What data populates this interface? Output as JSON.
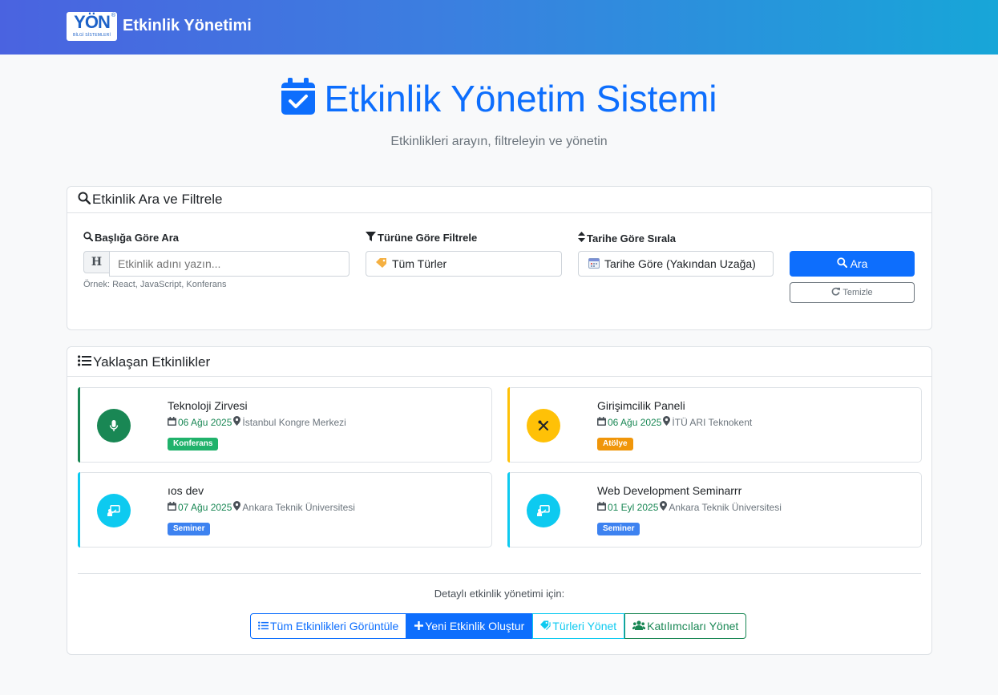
{
  "navbar": {
    "logo_text": "YÖN",
    "logo_sub": "BİLGİ SİSTEMLERİ",
    "logo_reg": "®",
    "brand": "Etkinlik Yönetimi"
  },
  "hero": {
    "title": "Etkinlik Yönetim Sistemi",
    "subtitle": "Etkinlikleri arayın, filtreleyin ve yönetin"
  },
  "search_card": {
    "header": "Etkinlik Ara ve Filtrele",
    "title_label": "Başlığa Göre Ara",
    "title_prefix": "H",
    "title_placeholder": "Etkinlik adını yazın...",
    "hint": "Örnek: React, JavaScript, Konferans",
    "type_label": "Türüne Göre Filtrele",
    "type_value": "Tüm Türler",
    "date_label": "Tarihe Göre Sırala",
    "date_value": "Tarihe Göre (Yakından Uzağa)",
    "search_button": "Ara",
    "clear_button": "Temizle"
  },
  "upcoming": {
    "header": "Yaklaşan Etkinlikler",
    "events": [
      {
        "title": "Teknoloji Zirvesi",
        "date": "06 Ağu 2025",
        "location": "İstanbul Kongre Merkezi",
        "badge": "Konferans",
        "icon": "microphone-icon",
        "accent": "#198754",
        "badge_color": "#20b26b"
      },
      {
        "title": "Girişimcilik Paneli",
        "date": "06 Ağu 2025",
        "location": "İTÜ ARI Teknokent",
        "badge": "Atölye",
        "icon": "tools-icon",
        "accent": "#ffc107",
        "badge_color": "#f0960a"
      },
      {
        "title": "ıos dev",
        "date": "07 Ağu 2025",
        "location": "Ankara Teknik Üniversitesi",
        "badge": "Seminer",
        "icon": "presentation-icon",
        "accent": "#0dcaf0",
        "badge_color": "#3d82f0"
      },
      {
        "title": "Web Development Seminarrr",
        "date": "01 Eyl 2025",
        "location": "Ankara Teknik Üniversitesi",
        "badge": "Seminer",
        "icon": "presentation-icon",
        "accent": "#0dcaf0",
        "badge_color": "#3d82f0"
      }
    ],
    "footer_text": "Detaylı etkinlik yönetimi için:",
    "buttons": {
      "view_all": "Tüm Etkinlikleri Görüntüle",
      "create": "Yeni Etkinlik Oluştur",
      "types": "Türleri Yönet",
      "participants": "Katılımcıları Yönet"
    }
  },
  "colors": {
    "primary": "#0d6efd",
    "info": "#0dcaf0",
    "success": "#198754",
    "warning": "#ffc107"
  }
}
